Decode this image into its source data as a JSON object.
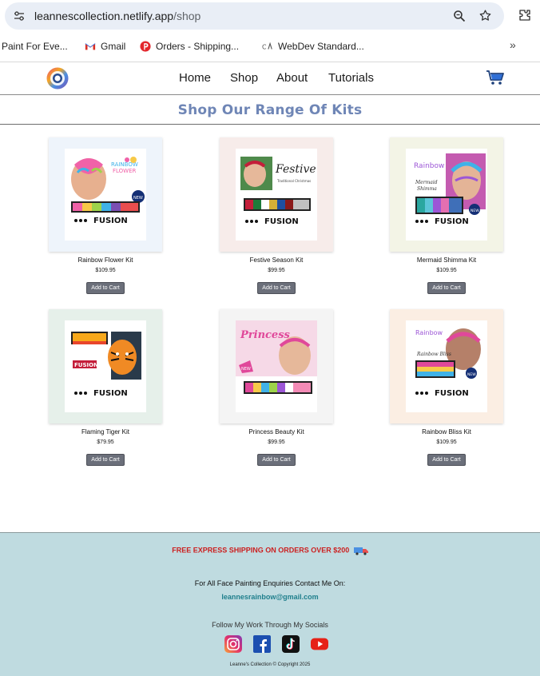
{
  "browser": {
    "url_host": "leannescollection.netlify.app",
    "url_path": "/shop",
    "bookmarks": [
      {
        "label": "Paint For Eve...",
        "icon": "none"
      },
      {
        "label": "Gmail",
        "icon": "gmail-icon"
      },
      {
        "label": "Orders - Shipping...",
        "icon": "orders-icon"
      },
      {
        "label": "WebDev Standard...",
        "icon": "webdev-icon"
      }
    ],
    "more": "»"
  },
  "nav": {
    "items": [
      "Home",
      "Shop",
      "About",
      "Tutorials"
    ]
  },
  "page": {
    "title": "Shop Our Range Of Kits"
  },
  "products": [
    {
      "name": "Rainbow Flower Kit",
      "price": "$109.95",
      "button": "Add to Cart",
      "bg": "#eef4fb"
    },
    {
      "name": "Festive Season Kit",
      "price": "$99.95",
      "button": "Add to Cart",
      "bg": "#f7ecea"
    },
    {
      "name": "Mermaid Shimma Kit",
      "price": "$109.95",
      "button": "Add to Cart",
      "bg": "#f3f4e6"
    },
    {
      "name": "Flaming Tiger Kit",
      "price": "$79.95",
      "button": "Add to Cart",
      "bg": "#e6f0ea"
    },
    {
      "name": "Princess Beauty Kit",
      "price": "$99.95",
      "button": "Add to Cart",
      "bg": "#f4f4f4"
    },
    {
      "name": "Rainbow Bliss Kit",
      "price": "$109.95",
      "button": "Add to Cart",
      "bg": "#fbeee3"
    }
  ],
  "footer": {
    "shipping": "FREE EXPRESS SHIPPING ON ORDERS OVER $200",
    "enquiry": "For All Face Painting Enquiries Contact Me On:",
    "email": "leannesrainbow@gmail.com",
    "follow": "Follow My Work Through My Socials",
    "socials": [
      "instagram-icon",
      "facebook-icon",
      "tiktok-icon",
      "youtube-icon"
    ],
    "copyright": "Leanne's Collection © Copyright 2025"
  },
  "colors": {
    "title": "#6f86b6",
    "footer_bg": "#bfdbe0",
    "shipping_text": "#cc1f1f",
    "email_text": "#1f7f8c",
    "button_bg": "#6b6f7a"
  }
}
